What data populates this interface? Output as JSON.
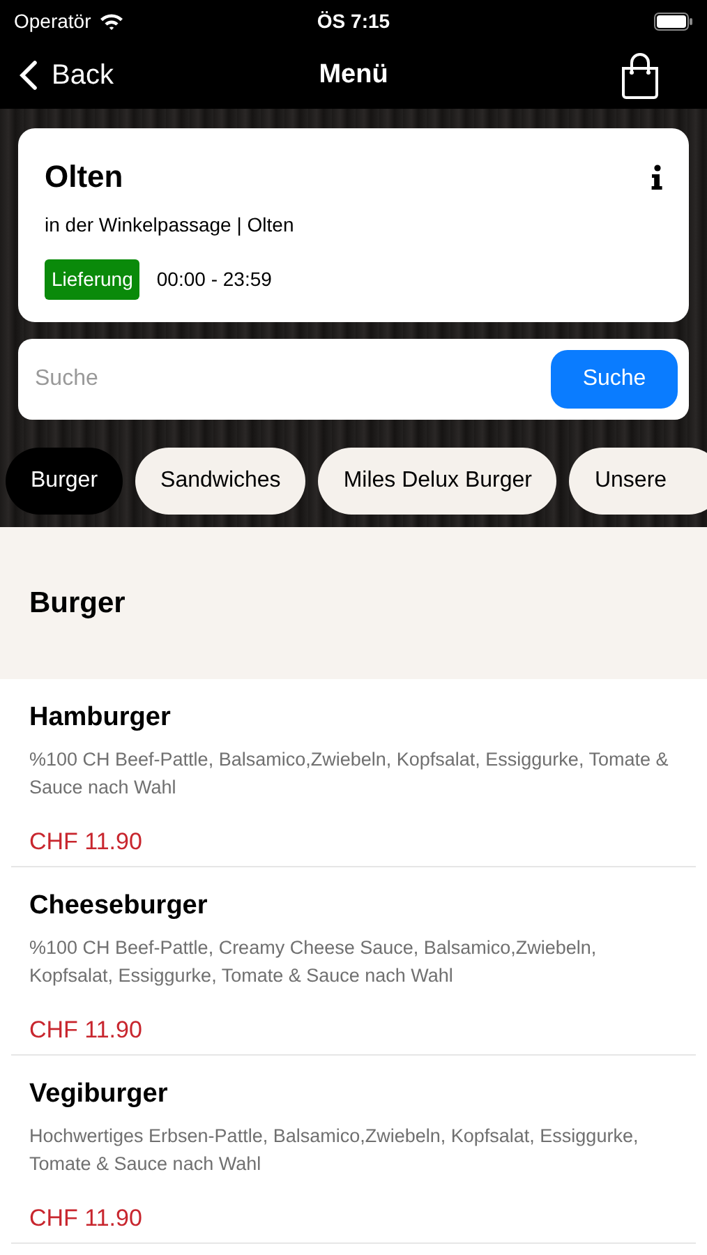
{
  "status_bar": {
    "carrier": "Operatör",
    "time": "ÖS 7:15"
  },
  "nav": {
    "back": "Back",
    "title": "Menü"
  },
  "store": {
    "name": "Olten",
    "address": "in der Winkelpassage | Olten",
    "badge": "Lieferung",
    "hours": "00:00 - 23:59"
  },
  "search": {
    "placeholder": "Suche",
    "button": "Suche"
  },
  "categories": [
    {
      "label": "Burger",
      "selected": true
    },
    {
      "label": "Sandwiches",
      "selected": false
    },
    {
      "label": "Miles Delux Burger",
      "selected": false
    },
    {
      "label": "Unsere",
      "selected": false
    }
  ],
  "section_title": "Burger",
  "items": [
    {
      "name": "Hamburger",
      "description": "%100 CH Beef-Pattle, Balsamico,Zwiebeln, Kopfsalat, Essiggurke, Tomate & Sauce nach Wahl",
      "price": "CHF 11.90"
    },
    {
      "name": "Cheeseburger",
      "description": "%100 CH Beef-Pattle, Creamy Cheese Sauce, Balsamico,Zwiebeln, Kopfsalat, Essiggurke, Tomate & Sauce nach Wahl",
      "price": "CHF 11.90"
    },
    {
      "name": "Vegiburger",
      "description": "Hochwertiges Erbsen-Pattle, Balsamico,Zwiebeln, Kopfsalat, Essiggurke, Tomate & Sauce nach Wahl",
      "price": "CHF 11.90"
    }
  ]
}
